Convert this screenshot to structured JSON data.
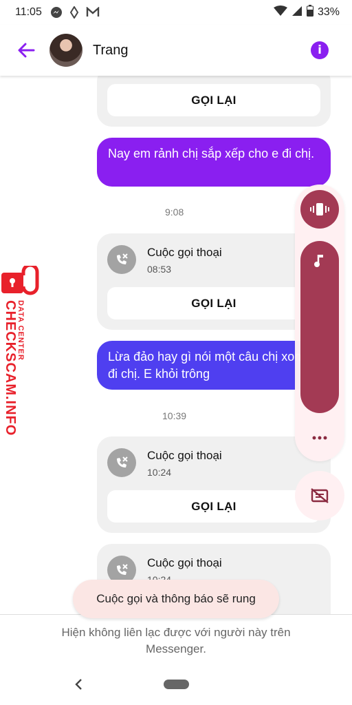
{
  "status_bar": {
    "time": "11:05",
    "battery": "33%"
  },
  "header": {
    "contact_name": "Trang"
  },
  "messages": [
    {
      "type": "call_card_partial",
      "callback_label": "GỌI LẠI"
    },
    {
      "type": "outgoing",
      "text": "Nay em rảnh chị sắp xếp cho e đi chị."
    },
    {
      "type": "timestamp",
      "text": "9:08"
    },
    {
      "type": "call_card",
      "title": "Cuộc gọi thoại",
      "time": "08:53",
      "callback_label": "GỌI LẠI"
    },
    {
      "type": "outgoing",
      "text": "Lừa đảo hay gì nói một câu chị xong đi chị. E khỏi trông"
    },
    {
      "type": "timestamp",
      "text": "10:39"
    },
    {
      "type": "call_card",
      "title": "Cuộc gọi thoại",
      "time": "10:24",
      "callback_label": "GỌI LẠI"
    },
    {
      "type": "call_card",
      "title": "Cuộc gọi thoại",
      "time": "10:24"
    }
  ],
  "watermark": {
    "line1": "DATA CENTER",
    "line2": "CHECKSCAM.INFO"
  },
  "volume_panel": {
    "ringer_mode": "vibrate",
    "level": 1.0
  },
  "toast": {
    "text": "Cuộc gọi và thông báo sẽ rung"
  },
  "footer": {
    "text": "Hiện không liên lạc được với người này trên Messenger."
  },
  "colors": {
    "accent_purple": "#8a1ff0",
    "bubble_1": "#8a1ff0",
    "bubble_2": "#4f3ff0",
    "volume_red": "#a33a54",
    "watermark_red": "#e8212b"
  },
  "icons": [
    "back-arrow-icon",
    "info-icon",
    "missed-call-icon",
    "vibrate-icon",
    "music-note-icon",
    "more-dots-icon",
    "captions-off-icon",
    "messenger-icon",
    "gmail-icon",
    "wifi-icon",
    "signal-icon",
    "battery-icon"
  ]
}
